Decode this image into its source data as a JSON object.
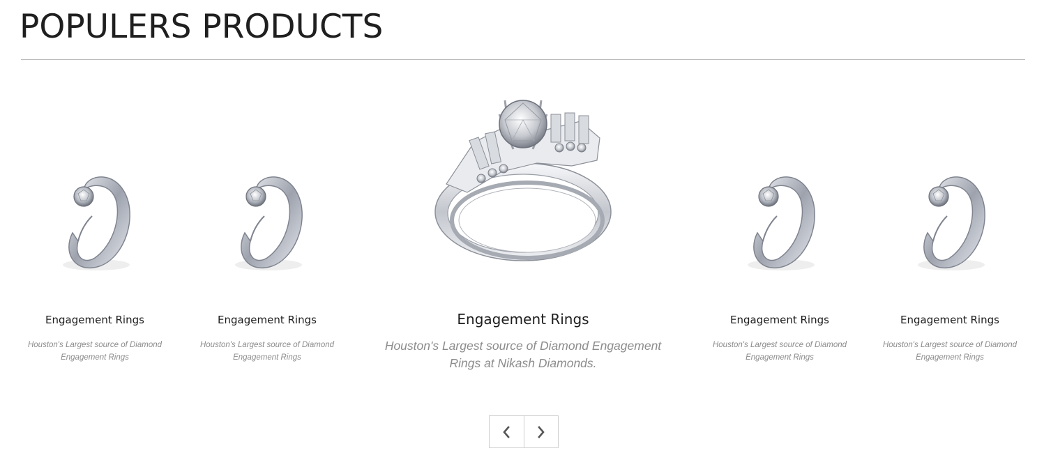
{
  "section": {
    "title": "POPULERS PRODUCTS"
  },
  "products": [
    {
      "name": "Engagement Rings",
      "description": "Houston's Largest source of Diamond Engagement Rings",
      "image_icon": "twist-solitaire-ring-icon"
    },
    {
      "name": "Engagement Rings",
      "description": "Houston's Largest source of Diamond Engagement Rings",
      "image_icon": "twist-solitaire-ring-icon"
    },
    {
      "name": "Engagement Rings",
      "description": "Houston's Largest source of Diamond Engagement Rings at Nikash Diamonds.",
      "image_icon": "bridal-set-ring-icon",
      "featured": true
    },
    {
      "name": "Engagement Rings",
      "description": "Houston's Largest source of Diamond Engagement Rings",
      "image_icon": "twist-solitaire-ring-icon"
    },
    {
      "name": "Engagement Rings",
      "description": "Houston's Largest source of Diamond Engagement Rings",
      "image_icon": "twist-solitaire-ring-icon"
    }
  ],
  "navigation": {
    "prev_icon": "chevron-left-icon",
    "next_icon": "chevron-right-icon"
  },
  "colors": {
    "title": "#1f1f1f",
    "divider": "#b9b9b9",
    "product_name": "#1d1d1d",
    "product_desc": "#8c8c8c",
    "nav_border": "#cfcfcf",
    "metal": "#c9ccd3"
  }
}
